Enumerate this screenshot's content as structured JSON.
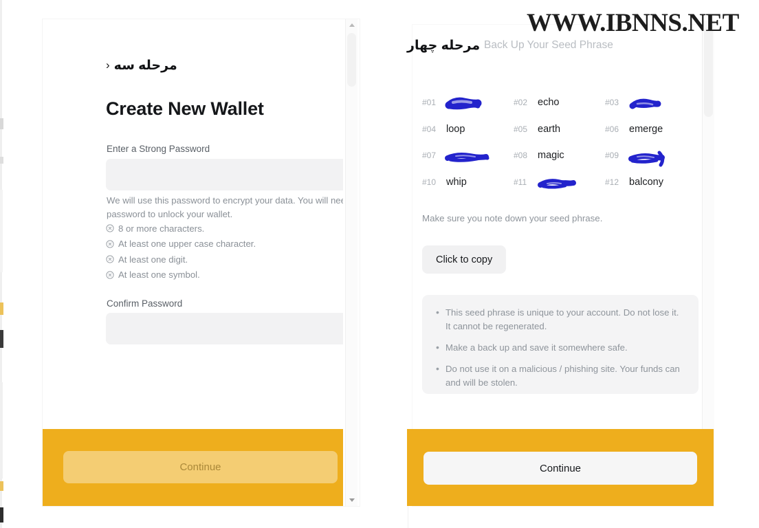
{
  "colors": {
    "accent_yellow": "#eeae1d",
    "text_primary": "#16181b",
    "text_muted": "#8e949b",
    "input_bg": "#f2f2f3",
    "redaction_blue": "#2323cc"
  },
  "watermark": {
    "text": "WWW.IBNNS.NET"
  },
  "left_panel": {
    "step_label": "مرحله سه",
    "back_chevron": "‹",
    "title": "Create New Wallet",
    "password_field": {
      "label": "Enter a Strong Password",
      "value": "",
      "placeholder": "",
      "toggle_icon": "eye-icon"
    },
    "help_text": "We will use this password to encrypt your data. You will need this password to unlock your wallet.",
    "requirements": [
      {
        "icon": "circle-x-icon",
        "label": "8 or more characters."
      },
      {
        "icon": "circle-x-icon",
        "label": "At least one upper case character."
      },
      {
        "icon": "circle-x-icon",
        "label": "At least one digit."
      },
      {
        "icon": "circle-x-icon",
        "label": "At least one symbol."
      }
    ],
    "confirm_field": {
      "label": "Confirm Password",
      "value": "",
      "placeholder": "",
      "toggle_icon": "eye-icon"
    },
    "continue_label": "Continue",
    "continue_state": "disabled"
  },
  "right_panel": {
    "step_label": "مرحله چهار",
    "heading": "Back Up Your Seed Phrase",
    "seed_words": [
      {
        "index": "#01",
        "word": "",
        "redacted": true
      },
      {
        "index": "#02",
        "word": "echo",
        "redacted": false
      },
      {
        "index": "#03",
        "word": "",
        "redacted": true
      },
      {
        "index": "#04",
        "word": "loop",
        "redacted": false
      },
      {
        "index": "#05",
        "word": "earth",
        "redacted": false
      },
      {
        "index": "#06",
        "word": "emerge",
        "redacted": false
      },
      {
        "index": "#07",
        "word": "",
        "redacted": true
      },
      {
        "index": "#08",
        "word": "magic",
        "redacted": false
      },
      {
        "index": "#09",
        "word": "",
        "redacted": true
      },
      {
        "index": "#10",
        "word": "whip",
        "redacted": false
      },
      {
        "index": "#11",
        "word": "",
        "redacted": true
      },
      {
        "index": "#12",
        "word": "balcony",
        "redacted": false
      }
    ],
    "note": "Make sure you note down your seed phrase.",
    "copy_label": "Click to copy",
    "warnings": [
      "This seed phrase is unique to your account. Do not lose it. It cannot be regenerated.",
      "Make a back up and save it somewhere safe.",
      "Do not use it on a malicious / phishing site. Your funds can and will be stolen."
    ],
    "continue_label": "Continue",
    "continue_state": "enabled"
  }
}
